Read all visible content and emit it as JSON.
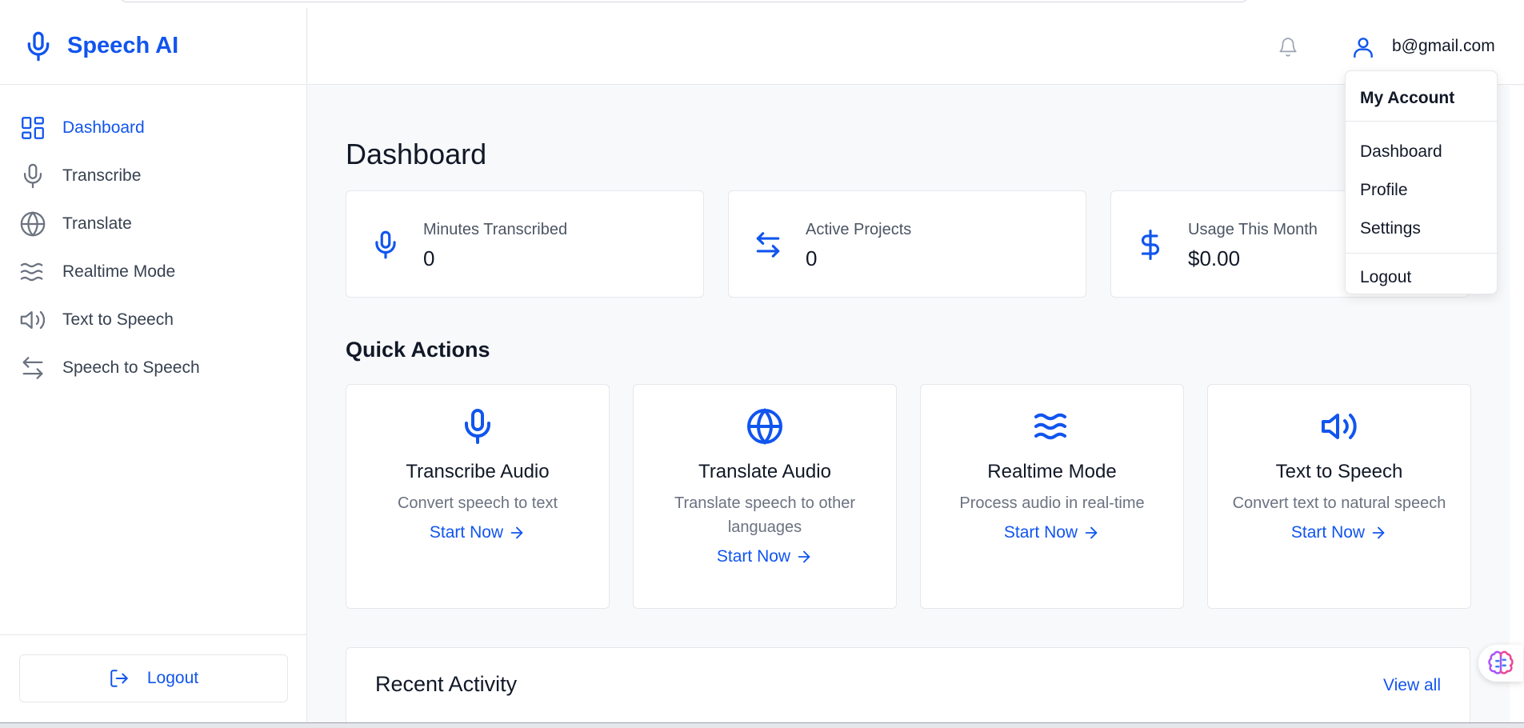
{
  "brand": {
    "name": "Speech AI",
    "icon": "microphone-icon"
  },
  "sidebar": {
    "items": [
      {
        "label": "Dashboard",
        "icon": "dashboard-grid-icon",
        "active": true
      },
      {
        "label": "Transcribe",
        "icon": "microphone-icon",
        "active": false
      },
      {
        "label": "Translate",
        "icon": "globe-icon",
        "active": false
      },
      {
        "label": "Realtime Mode",
        "icon": "waves-icon",
        "active": false
      },
      {
        "label": "Text to Speech",
        "icon": "speaker-icon",
        "active": false
      },
      {
        "label": "Speech to Speech",
        "icon": "arrows-left-right-icon",
        "active": false
      }
    ],
    "logout_label": "Logout"
  },
  "header": {
    "user_email": "b@gmail.com"
  },
  "main": {
    "title": "Dashboard",
    "stats": [
      {
        "label": "Minutes Transcribed",
        "value": "0",
        "icon": "microphone-icon"
      },
      {
        "label": "Active Projects",
        "value": "0",
        "icon": "arrows-left-right-icon"
      },
      {
        "label": "Usage This Month",
        "value": "$0.00",
        "icon": "dollar-icon"
      }
    ],
    "quick_actions_title": "Quick Actions",
    "quick_actions": [
      {
        "title": "Transcribe Audio",
        "desc": "Convert speech to text",
        "link": "Start Now",
        "icon": "microphone-icon"
      },
      {
        "title": "Translate Audio",
        "desc": "Translate speech to other languages",
        "link": "Start Now",
        "icon": "globe-icon"
      },
      {
        "title": "Realtime Mode",
        "desc": "Process audio in real-time",
        "link": "Start Now",
        "icon": "waves-icon"
      },
      {
        "title": "Text to Speech",
        "desc": "Convert text to natural speech",
        "link": "Start Now",
        "icon": "speaker-icon"
      }
    ],
    "recent_activity_title": "Recent Activity",
    "view_all_label": "View all"
  },
  "dropdown": {
    "header": "My Account",
    "items": [
      "Dashboard",
      "Profile",
      "Settings"
    ],
    "logout": "Logout"
  },
  "colors": {
    "accent": "#1155ee",
    "border": "#e5e7eb",
    "background": "#f8f9fb"
  }
}
